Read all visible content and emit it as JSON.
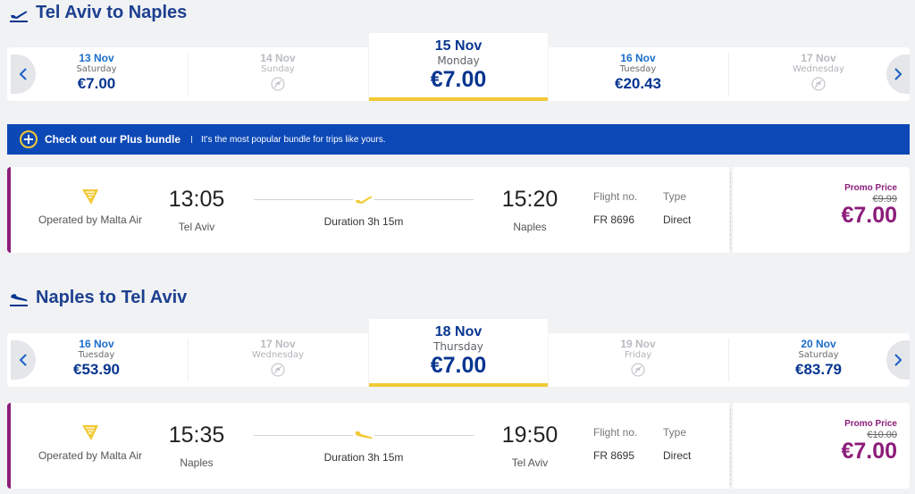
{
  "outbound": {
    "title": "Tel Aviv to Naples",
    "dates": [
      {
        "date": "13 Nov",
        "day": "Saturday",
        "price": "€7.00",
        "available": true
      },
      {
        "date": "14 Nov",
        "day": "Sunday",
        "price": "",
        "available": false
      },
      {
        "date": "15 Nov",
        "day": "Monday",
        "price": "€7.00",
        "available": true,
        "selected": true
      },
      {
        "date": "16 Nov",
        "day": "Tuesday",
        "price": "€20.43",
        "available": true
      },
      {
        "date": "17 Nov",
        "day": "Wednesday",
        "price": "",
        "available": false
      }
    ],
    "flight": {
      "operator": "Operated by Malta Air",
      "depart_time": "13:05",
      "depart_city": "Tel Aviv",
      "duration": "Duration 3h 15m",
      "arrive_time": "15:20",
      "arrive_city": "Naples",
      "flight_no_label": "Flight no.",
      "flight_no": "FR 8696",
      "type_label": "Type",
      "type": "Direct",
      "promo_label": "Promo Price",
      "old_price": "€9.99",
      "price": "€7.00"
    }
  },
  "banner": {
    "title": "Check out our Plus bundle",
    "text": "It's the most popular bundle for trips like yours."
  },
  "inbound": {
    "title": "Naples to Tel Aviv",
    "dates": [
      {
        "date": "16 Nov",
        "day": "Tuesday",
        "price": "€53.90",
        "available": true
      },
      {
        "date": "17 Nov",
        "day": "Wednesday",
        "price": "",
        "available": false
      },
      {
        "date": "18 Nov",
        "day": "Thursday",
        "price": "€7.00",
        "available": true,
        "selected": true
      },
      {
        "date": "19 Nov",
        "day": "Friday",
        "price": "",
        "available": false
      },
      {
        "date": "20 Nov",
        "day": "Saturday",
        "price": "€83.79",
        "available": true
      }
    ],
    "flight": {
      "operator": "Operated by Malta Air",
      "depart_time": "15:35",
      "depart_city": "Naples",
      "duration": "Duration 3h 15m",
      "arrive_time": "19:50",
      "arrive_city": "Tel Aviv",
      "flight_no_label": "Flight no.",
      "flight_no": "FR 8695",
      "type_label": "Type",
      "type": "Direct",
      "promo_label": "Promo Price",
      "old_price": "€10.00",
      "price": "€7.00"
    }
  },
  "colors": {
    "brand_blue": "#073590",
    "accent_yellow": "#f1c933",
    "promo_purple": "#8c1c7a",
    "banner_blue": "#0d49b6"
  },
  "icons": {
    "departure": "plane-takeoff-icon",
    "arrival": "plane-landing-icon",
    "no_flight": "no-flight-icon",
    "operator": "harp-logo-icon",
    "plus": "plus-circle-icon"
  }
}
